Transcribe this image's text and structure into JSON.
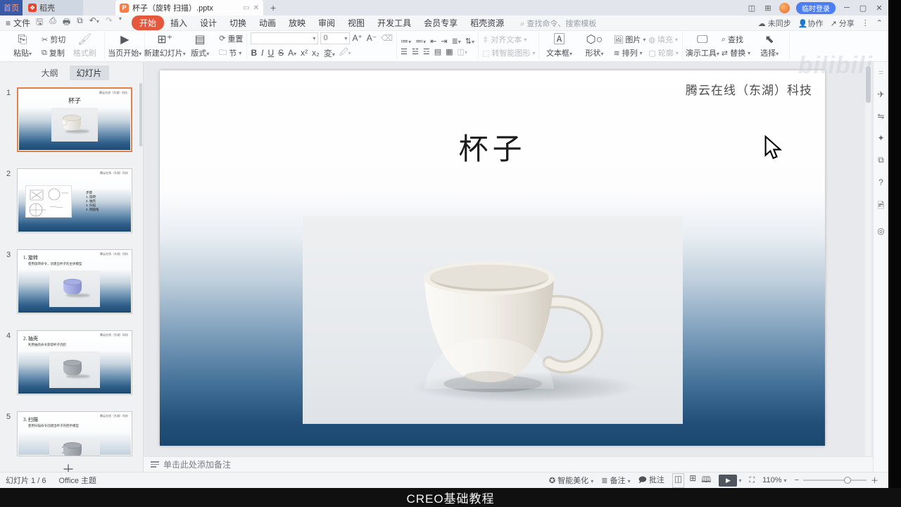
{
  "titlebar": {
    "home": "首页",
    "docer": "稻壳",
    "doc_tab": "杯子（旋转 扫描）.pptx",
    "login": "临时登录"
  },
  "menubar": {
    "file": "文件",
    "tabs": [
      "开始",
      "插入",
      "设计",
      "切换",
      "动画",
      "放映",
      "审阅",
      "视图",
      "开发工具",
      "会员专享",
      "稻壳资源"
    ],
    "search_placeholder": "查找命令、搜索模板",
    "sync": "未同步",
    "collab": "协作",
    "share": "分享"
  },
  "ribbon": {
    "paste": "粘贴",
    "cut": "剪切",
    "copy": "复制",
    "format_painter": "格式刷",
    "play_current": "当页开始",
    "new_slide": "新建幻灯片",
    "layout": "版式",
    "reset": "重置",
    "section": "节",
    "font_name": "",
    "font_size": "0",
    "align_text": "对齐文本",
    "smart_graphic": "转智能图形",
    "text_box": "文本框",
    "shapes": "形状",
    "picture": "图片",
    "fill": "填充",
    "arrange": "排列",
    "outline": "轮廓",
    "present_tools": "演示工具",
    "find": "查找",
    "replace": "替换",
    "select": "选择"
  },
  "watermark": "bilibili",
  "panel": {
    "outline_tab": "大纲",
    "slides_tab": "幻灯片",
    "thumbs": [
      {
        "num": "1",
        "title": "杯子",
        "header": "腾云在线（东湖）科技"
      },
      {
        "num": "2",
        "header": "腾云在线（东湖）科技",
        "label": "步骤",
        "step1": "1. 旋转",
        "step2": "2. 抽壳",
        "step3": "3. 扫描",
        "step4": "4. 倒圆角"
      },
      {
        "num": "3",
        "title": "1. 旋转",
        "desc": "使用旋转命令，创建出杯子的主体模型",
        "header": "腾云在线（东湖）科技"
      },
      {
        "num": "4",
        "title": "2. 抽壳",
        "desc": "利用抽壳命令获得杯子内腔",
        "header": "腾云在线（东湖）科技"
      },
      {
        "num": "5",
        "title": "3. 扫描",
        "desc": "使用扫描命令创建出杯子的把手模型",
        "header": "腾云在线（东湖）科技"
      }
    ]
  },
  "slide": {
    "header": "腾云在线（东湖）科技",
    "title": "杯子"
  },
  "notes": {
    "placeholder": "单击此处添加备注"
  },
  "statusbar": {
    "slide_info": "幻灯片 1 / 6",
    "theme": "Office 主题",
    "beautify": "智能美化",
    "note": "备注",
    "comment": "批注",
    "zoom": "110%"
  },
  "caption": "CREO基础教程",
  "colors": {
    "accent": "#e4583e",
    "selected_thumb_border": "#e0804a",
    "slide_bottom_blue": "#1a4770"
  }
}
